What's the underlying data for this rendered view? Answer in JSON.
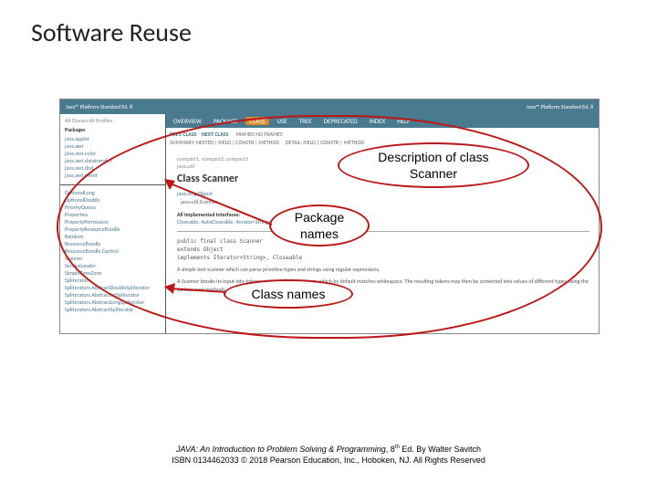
{
  "slide": {
    "title": "Software Reuse"
  },
  "javadoc": {
    "top_left": "Java™ Platform\nStandard Ed. 8",
    "top_right": "Java™ Platform\nStandard Ed. 8",
    "nav": {
      "overview": "OVERVIEW",
      "package": "PACKAGE",
      "class": "CLASS",
      "use": "USE",
      "tree": "TREE",
      "deprecated": "DEPRECATED",
      "index": "INDEX",
      "help": "HELP"
    },
    "subnav": {
      "prev": "PREV CLASS",
      "next": "NEXT CLASS",
      "frames": "FRAMES   NO FRAMES",
      "summary": "SUMMARY: NESTED | FIELD | CONSTR | METHOD",
      "detail": "DETAIL: FIELD | CONSTR | METHOD"
    },
    "left_top": {
      "allclasses": "All Classes   All Profiles",
      "packages_hdr": "Packages",
      "packages": [
        "java.applet",
        "java.awt",
        "java.awt.color",
        "java.awt.datatransfer",
        "java.awt.dnd",
        "java.awt.event"
      ]
    },
    "left_bot": {
      "items": [
        "OptionalLong",
        "OptionalDouble",
        "PriorityQueue",
        "Properties",
        "PropertyPermission",
        "PropertyResourceBundle",
        "Random",
        "ResourceBundle",
        "ResourceBundle.Control",
        "Scanner",
        "ServiceLoader",
        "SimpleTimeZone",
        "Spliterators",
        "Spliterators.AbstractDoubleSpliterator",
        "Spliterators.AbstractIntSpliterator",
        "Spliterators.AbstractLongSpliterator",
        "Spliterators.AbstractSpliterator"
      ]
    },
    "main": {
      "compact": "compact1, compact2, compact3",
      "pkg": "java.util",
      "classname": "Class Scanner",
      "hier1": "java.lang.Object",
      "hier2": "java.util.Scanner",
      "impl_label": "All Implemented Interfaces:",
      "impl_list": "Closeable, AutoCloseable, Iterator<String>",
      "sig1": "public final class Scanner",
      "sig2": "extends Object",
      "sig3": "implements Iterator<String>, Closeable",
      "body1": "A simple text scanner which can parse primitive types and strings using regular expressions.",
      "body2": "A Scanner breaks its input into tokens using a delimiter pattern, which by default matches whitespace. The resulting tokens may then be converted into values of different types using the various next methods."
    }
  },
  "callouts": {
    "desc1": "Description of class",
    "desc2": "Scanner",
    "pkg1": "Package",
    "pkg2": "names",
    "cls": "Class names"
  },
  "footer": {
    "line1a": "JAVA: An Introduction to Problem Solving & Programming",
    "line1b": ", 8",
    "line1c": "th",
    "line1d": " Ed. By Walter Savitch",
    "line2": "ISBN 0134462033 © 2018 Pearson Education, Inc., Hoboken, NJ. All Rights Reserved"
  }
}
